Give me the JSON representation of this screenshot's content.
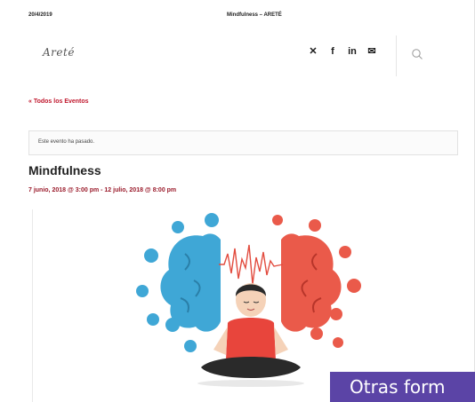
{
  "print_header": {
    "date": "20/4/2019",
    "title": "Mindfulness – ARETÉ"
  },
  "site": {
    "logo_text": "Areté"
  },
  "social_icons": [
    "twitter-icon",
    "facebook-icon",
    "linkedin-icon",
    "email-icon"
  ],
  "social_glyphs": [
    "✕",
    "f",
    "in",
    "✉"
  ],
  "nav": {
    "back_link": "« Todos los Eventos"
  },
  "notice": {
    "text": "Este evento ha pasado."
  },
  "event": {
    "title": "Mindfulness",
    "dates": "7 junio, 2018 @ 3:00 pm - 12 julio, 2018 @ 8:00 pm"
  },
  "cta": {
    "label": "Otras form"
  },
  "colors": {
    "accent": "#c0172d",
    "cta_bg": "#5b44a6",
    "brain_left": "#3fa7d6",
    "brain_right": "#ea5a4a"
  }
}
